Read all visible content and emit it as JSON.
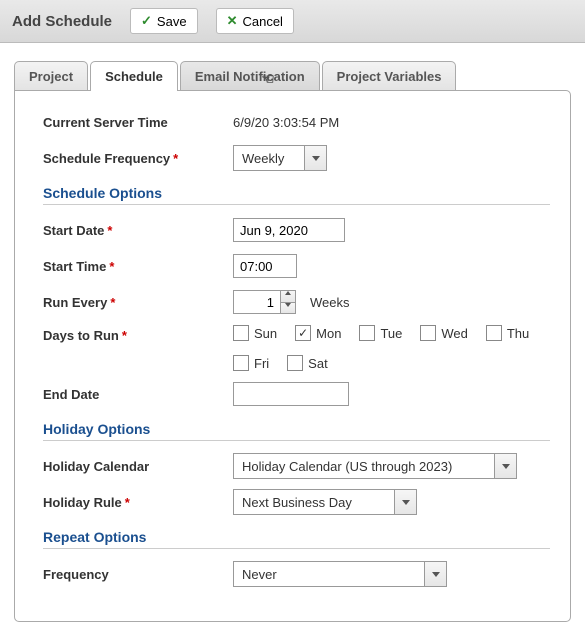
{
  "header": {
    "title": "Add Schedule",
    "save_label": "Save",
    "cancel_label": "Cancel"
  },
  "tabs": {
    "project": "Project",
    "schedule": "Schedule",
    "email_notification": "Email Notification",
    "project_variables": "Project Variables",
    "active": "schedule",
    "hovered": "email_notification"
  },
  "general": {
    "server_time_label": "Current Server Time",
    "server_time_value": "6/9/20 3:03:54 PM",
    "frequency_label": "Schedule Frequency",
    "frequency_value": "Weekly"
  },
  "schedule_options": {
    "section_title": "Schedule Options",
    "start_date_label": "Start Date",
    "start_date_value": "Jun 9, 2020",
    "start_time_label": "Start Time",
    "start_time_value": "07:00",
    "run_every_label": "Run Every",
    "run_every_value": "1",
    "run_every_unit": "Weeks",
    "days_label": "Days to Run",
    "days": {
      "sun": {
        "label": "Sun",
        "checked": false
      },
      "mon": {
        "label": "Mon",
        "checked": true
      },
      "tue": {
        "label": "Tue",
        "checked": false
      },
      "wed": {
        "label": "Wed",
        "checked": false
      },
      "thu": {
        "label": "Thu",
        "checked": false
      },
      "fri": {
        "label": "Fri",
        "checked": false
      },
      "sat": {
        "label": "Sat",
        "checked": false
      }
    },
    "end_date_label": "End Date",
    "end_date_value": ""
  },
  "holiday_options": {
    "section_title": "Holiday Options",
    "calendar_label": "Holiday Calendar",
    "calendar_value": "Holiday Calendar (US through 2023)",
    "rule_label": "Holiday Rule",
    "rule_value": "Next Business Day"
  },
  "repeat_options": {
    "section_title": "Repeat Options",
    "frequency_label": "Frequency",
    "frequency_value": "Never"
  }
}
